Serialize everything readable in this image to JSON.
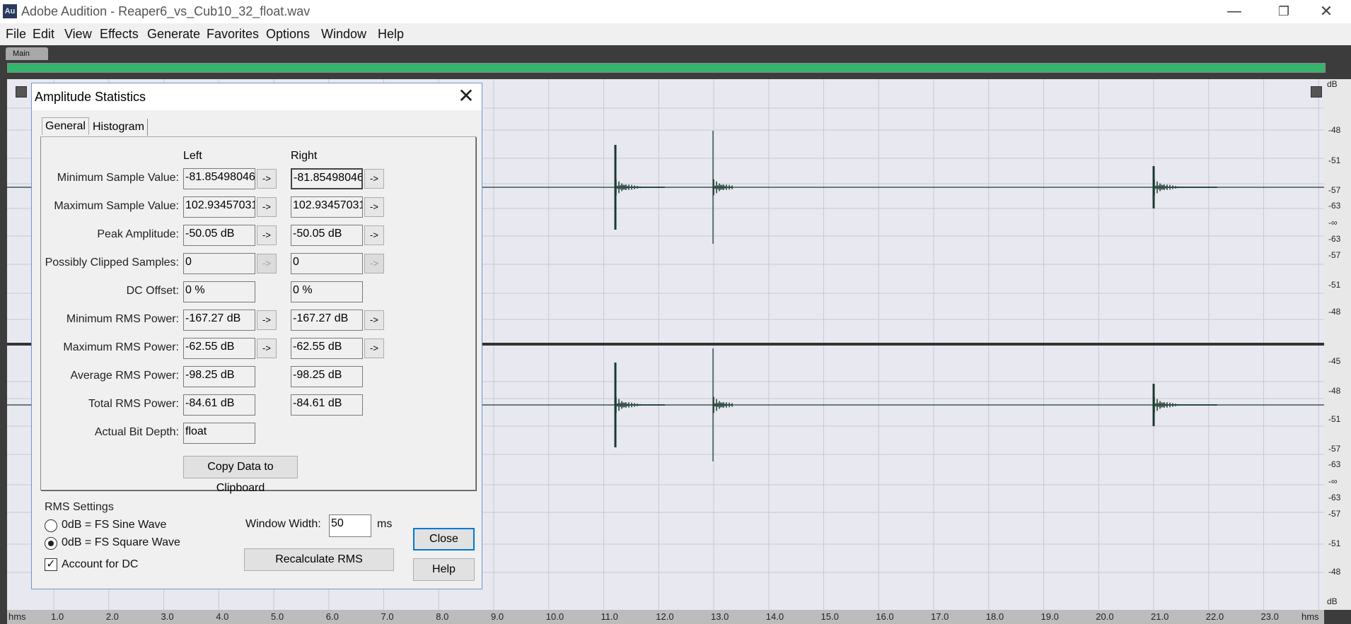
{
  "window": {
    "app_icon_text": "Au",
    "title": "Adobe Audition - Reaper6_vs_Cub10_32_float.wav",
    "minimize_glyph": "—",
    "restore_glyph": "❐",
    "close_glyph": "✕"
  },
  "menu": [
    "File",
    "Edit",
    "View",
    "Effects",
    "Generate",
    "Favorites",
    "Options",
    "Window",
    "Help"
  ],
  "editor": {
    "main_tab_label": "Main",
    "db_top_label": "dB",
    "db_bottom_label": "dB",
    "db_ruler_labels": [
      "-48",
      "-51",
      "-57",
      "-63",
      "-∞",
      "-63",
      "-57",
      "-51",
      "-48",
      "-45",
      "-48",
      "-51",
      "-57",
      "-63",
      "-∞",
      "-63",
      "-57",
      "-51",
      "-48"
    ],
    "time_ruler_labels": [
      "hms",
      "1.0",
      "2.0",
      "3.0",
      "4.0",
      "5.0",
      "6.0",
      "7.0",
      "8.0",
      "9.0",
      "10.0",
      "11.0",
      "12.0",
      "13.0",
      "14.0",
      "15.0",
      "16.0",
      "17.0",
      "18.0",
      "19.0",
      "20.0",
      "21.0",
      "22.0",
      "23.0",
      "hms"
    ],
    "colors": {
      "waveform": "#1a3a2e",
      "background": "#e8e8f1",
      "overview_bar": "#36b36c"
    }
  },
  "dialog": {
    "title": "Amplitude Statistics",
    "close_x": "✕",
    "tabs": [
      "General",
      "Histogram"
    ],
    "active_tab": "General",
    "column_headers": {
      "left": "Left",
      "right": "Right"
    },
    "rows": [
      {
        "label": "Minimum Sample Value:",
        "left": "-81.85498046",
        "right": "-81.85498046",
        "arrow": true,
        "arrow_enabled": true
      },
      {
        "label": "Maximum Sample Value:",
        "left": "102.93457031",
        "right": "102.93457031",
        "arrow": true,
        "arrow_enabled": true
      },
      {
        "label": "Peak Amplitude:",
        "left": "-50.05 dB",
        "right": "-50.05 dB",
        "arrow": true,
        "arrow_enabled": true
      },
      {
        "label": "Possibly Clipped Samples:",
        "left": "0",
        "right": "0",
        "arrow": true,
        "arrow_enabled": false
      },
      {
        "label": "DC Offset:",
        "left": "0 %",
        "right": "0 %",
        "arrow": false
      },
      {
        "label": "Minimum RMS Power:",
        "left": "-167.27 dB",
        "right": "-167.27 dB",
        "arrow": true,
        "arrow_enabled": true
      },
      {
        "label": "Maximum RMS Power:",
        "left": "-62.55 dB",
        "right": "-62.55 dB",
        "arrow": true,
        "arrow_enabled": true
      },
      {
        "label": "Average RMS Power:",
        "left": "-98.25 dB",
        "right": "-98.25 dB",
        "arrow": false
      },
      {
        "label": "Total RMS Power:",
        "left": "-84.61 dB",
        "right": "-84.61 dB",
        "arrow": false
      },
      {
        "label": "Actual Bit Depth:",
        "left": "float",
        "right": null,
        "arrow": false
      }
    ],
    "arrow_label": "->",
    "copy_button": "Copy Data to Clipboard",
    "rms_settings": {
      "group_label": "RMS Settings",
      "options": [
        "0dB = FS Sine Wave",
        "0dB = FS Square Wave"
      ],
      "selected": "0dB = FS Square Wave",
      "account_dc_label": "Account for DC",
      "account_dc_checked": true,
      "check_glyph": "✓",
      "window_width_label": "Window Width:",
      "window_width_value": "50",
      "window_width_unit": "ms",
      "recalc_button": "Recalculate RMS"
    },
    "close_button": "Close",
    "help_button": "Help"
  }
}
